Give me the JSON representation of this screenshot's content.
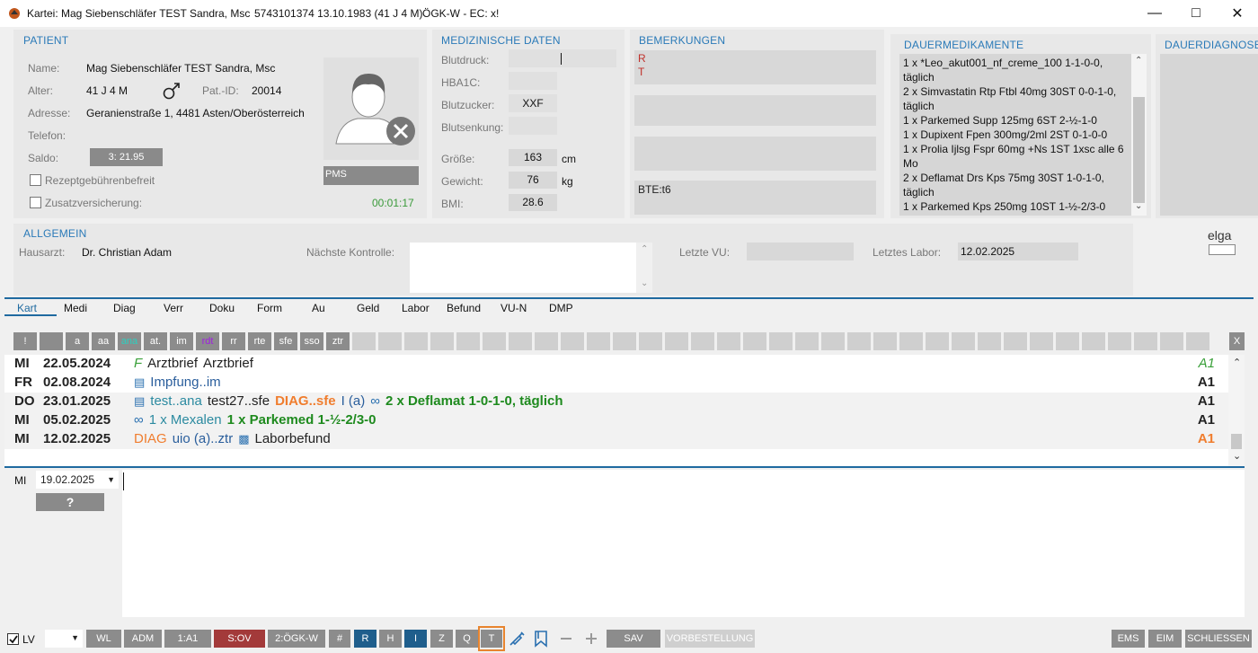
{
  "window": {
    "title": "Kartei: Mag Siebenschläfer TEST Sandra, Msc",
    "patient_meta": "5743101374 13.10.1983 (41 J 4 M)",
    "ogk": "ÖGK-W - EC: x!"
  },
  "patient": {
    "section": "PATIENT",
    "name_label": "Name:",
    "name": "Mag Siebenschläfer TEST Sandra, Msc",
    "age_label": "Alter:",
    "age": "41 J 4 M",
    "patid_label": "Pat.-ID:",
    "patid": "20014",
    "address_label": "Adresse:",
    "address": "Geranienstraße 1, 4481 Asten/Oberösterreich",
    "phone_label": "Telefon:",
    "saldo_label": "Saldo:",
    "saldo": "3: 21.95",
    "rezept_label": "Rezeptgebührenbefreit",
    "zusatz_label": "Zusatzversicherung:",
    "pms": "PMS",
    "timer": "00:01:17"
  },
  "medical": {
    "section": "MEDIZINISCHE DATEN",
    "blutdruck_label": "Blutdruck:",
    "hba1c_label": "HBA1C:",
    "blutzucker_label": "Blutzucker:",
    "blutzucker": "XXF",
    "blutsenkung_label": "Blutsenkung:",
    "groesse_label": "Größe:",
    "groesse": "163",
    "groesse_unit": "cm",
    "gewicht_label": "Gewicht:",
    "gewicht": "76",
    "gewicht_unit": "kg",
    "bmi_label": "BMI:",
    "bmi": "28.6"
  },
  "remarks": {
    "section": "BEMERKUNGEN",
    "line1": "R",
    "line2": "T",
    "bte": "BTE:t6"
  },
  "meds": {
    "section": "DAUERMEDIKAMENTE",
    "items": [
      "1 x *Leo_akut001_nf_creme_100 1-1-0-0, täglich",
      "2 x Simvastatin Rtp Ftbl 40mg 30ST 0-0-1-0, täglich",
      "1 x Parkemed Supp 125mg 6ST 2-½-1-0",
      "1 x Dupixent Fpen 300mg/2ml 2ST 0-1-0-0",
      "1 x Prolia Ijlsg Fspr 60mg +Ns 1ST 1xsc alle 6 Mo",
      "2 x Deflamat Drs Kps  75mg 30ST 1-0-1-0, täglich",
      "1 x Parkemed Kps 250mg 10ST 1-½-2/3-0"
    ]
  },
  "diag": {
    "section": "DAUERDIAGNOSEN"
  },
  "general": {
    "section": "ALLGEMEIN",
    "hausarzt_label": "Hausarzt:",
    "hausarzt": "Dr. Christian Adam",
    "kontrolle_label": "Nächste Kontrolle:",
    "vu_label": "Letzte VU:",
    "labor_label": "Letztes Labor:",
    "labor": "12.02.2025",
    "elga": "elga"
  },
  "tabs": [
    "Kart",
    "Medi",
    "Diag",
    "Verr",
    "Doku",
    "Form",
    "Au",
    "Geld",
    "Labor",
    "Befund",
    "VU-N",
    "DMP"
  ],
  "toolbar": {
    "buttons": [
      "!",
      "",
      "a",
      "aa",
      "ana",
      "at.",
      "im",
      "rdt",
      "rr",
      "rte",
      "sfe",
      "sso",
      "ztr"
    ],
    "close": "X"
  },
  "entries": [
    {
      "day": "MI",
      "date": "22.05.2024",
      "a": "Arztbrief",
      "b": "Arztbrief",
      "code": "A1"
    },
    {
      "day": "FR",
      "date": "02.08.2024",
      "a": "Impfung..im",
      "code": "A1"
    },
    {
      "day": "DO",
      "date": "23.01.2025",
      "a": "test..ana",
      "b": "test27..sfe",
      "c": "DIAG..sfe",
      "d": "I (a)",
      "e": "2 x Deflamat 1-0-1-0, täglich",
      "code": "A1"
    },
    {
      "day": "MI",
      "date": "05.02.2025",
      "a": "1 x Mexalen",
      "b": "1 x Parkemed 1-½-2/3-0",
      "code": "A1"
    },
    {
      "day": "MI",
      "date": "12.02.2025",
      "a": "DIAG",
      "b": "uio (a)..ztr",
      "c": "Laborbefund",
      "code": "A1"
    }
  ],
  "editor": {
    "day": "MI",
    "date": "19.02.2025",
    "help": "?"
  },
  "bottom": {
    "lv": "LV",
    "buttons": [
      "WL",
      "ADM",
      "1:A1",
      "S:OV",
      "2:ÖGK-W",
      "#",
      "R",
      "H",
      "I",
      "Z",
      "Q",
      "T"
    ],
    "sav": "SAV",
    "vorbestellung": "VORBESTELLUNG",
    "ems": "EMS",
    "eim": "EIM",
    "schliessen": "SCHLIESSEN"
  },
  "colors": {
    "accent": "#2a7ab8",
    "orange": "#f07d2e",
    "green": "#1e8a1e",
    "red_button": "#a33a3a",
    "blue_button": "#1f5e8c"
  }
}
